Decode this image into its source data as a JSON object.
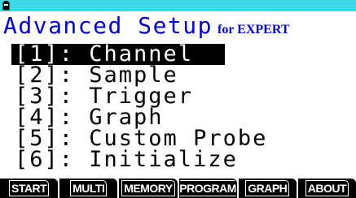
{
  "title": "Advanced Setup",
  "subtitle": "for EXPERT",
  "status_icon": "battery-icon",
  "colors": {
    "status_bar": "#3dd9e8",
    "title": "#0000cc",
    "selection_bg": "#000000",
    "selection_fg": "#ffffff"
  },
  "menu": [
    {
      "label": "[1]: Channel",
      "selected": true
    },
    {
      "label": "[2]: Sample",
      "selected": false
    },
    {
      "label": "[3]: Trigger",
      "selected": false
    },
    {
      "label": "[4]: Graph",
      "selected": false
    },
    {
      "label": "[5]: Custom Probe",
      "selected": false
    },
    {
      "label": "[6]: Initialize",
      "selected": false
    }
  ],
  "function_keys": [
    "START",
    "MULTI",
    "MEMORY",
    "PROGRAM",
    "GRAPH",
    "ABOUT"
  ]
}
